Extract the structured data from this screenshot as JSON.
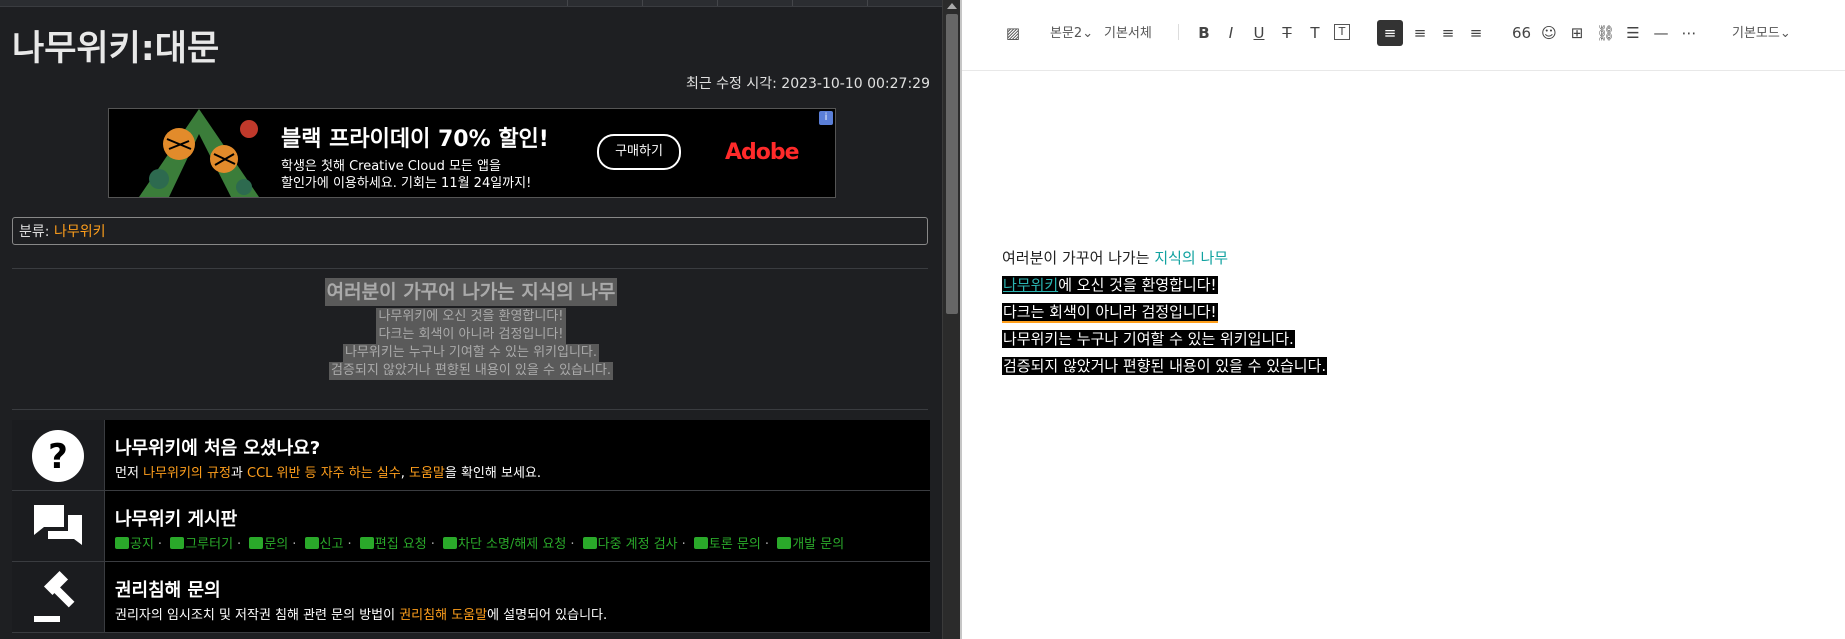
{
  "left": {
    "page_title": "나무위키:대문",
    "modified": "최근 수정 시각: 2023-10-10 00:27:29",
    "ad": {
      "headline": "블랙 프라이데이 70% 할인!",
      "sub1": "학생은 첫해 Creative Cloud 모든 앱을",
      "sub2": "할인가에 이용하세요. 기회는 11월 24일까지!",
      "button": "구매하기",
      "brand": "Adobe"
    },
    "category": {
      "label": "분류: ",
      "link": "나무위키"
    },
    "welcome": [
      "여러분이 가꾸어 나가는 지식의 나무",
      "나무위키에 오신 것을 환영합니다!",
      "다크는 회색이 아니라 검정입니다!",
      "나무위키는 누구나 기여할 수 있는 위키입니다.",
      "검증되지 않았거나 편향된 내용이 있을 수 있습니다."
    ],
    "rows": {
      "first": {
        "title": "나무위키에 처음 오셨나요?",
        "d1": "먼저 ",
        "l1": "나무위키의 규정",
        "d2": "과 ",
        "l2": "CCL 위반 등 자주 하는 실수",
        "d3": ", ",
        "l3": "도움말",
        "d4": "을 확인해 보세요."
      },
      "board": {
        "title": "나무위키 게시판",
        "links": [
          "공지",
          "그루터기",
          "문의",
          "신고",
          "편집 요청",
          "차단 소명/해제 요청",
          "다중 계정 검사",
          "토론 문의",
          "개발 문의"
        ]
      },
      "rights": {
        "title": "권리침해 문의",
        "d1": "권리자의 임시조치 및 저작권 침해 관련 문의 방법이 ",
        "l1": "권리침해 도움말",
        "d2": "에 설명되어 있습니다."
      }
    }
  },
  "editor": {
    "toolbar": {
      "image_icon": "image-icon",
      "para_style": "본문2",
      "font": "기본서체",
      "mode": "기본모드"
    },
    "lines": {
      "l1_a": "여러분이 가꾸어 나가는 ",
      "l1_b": "지식의 나무",
      "l2_a": "나무위키",
      "l2_b": "에 오신 것을 환영합니다!",
      "l3": "다크는 회색이 아니라 검정입니다!",
      "l4": "나무위키는 누구나 기여할 수 있는 위키입니다.",
      "l5": "검증되지 않았거나 편향된 내용이 있을 수 있습니다."
    }
  },
  "colors": {
    "orange": "#ff9f1c",
    "green": "#2aa92a",
    "teal": "#11a2a0"
  }
}
